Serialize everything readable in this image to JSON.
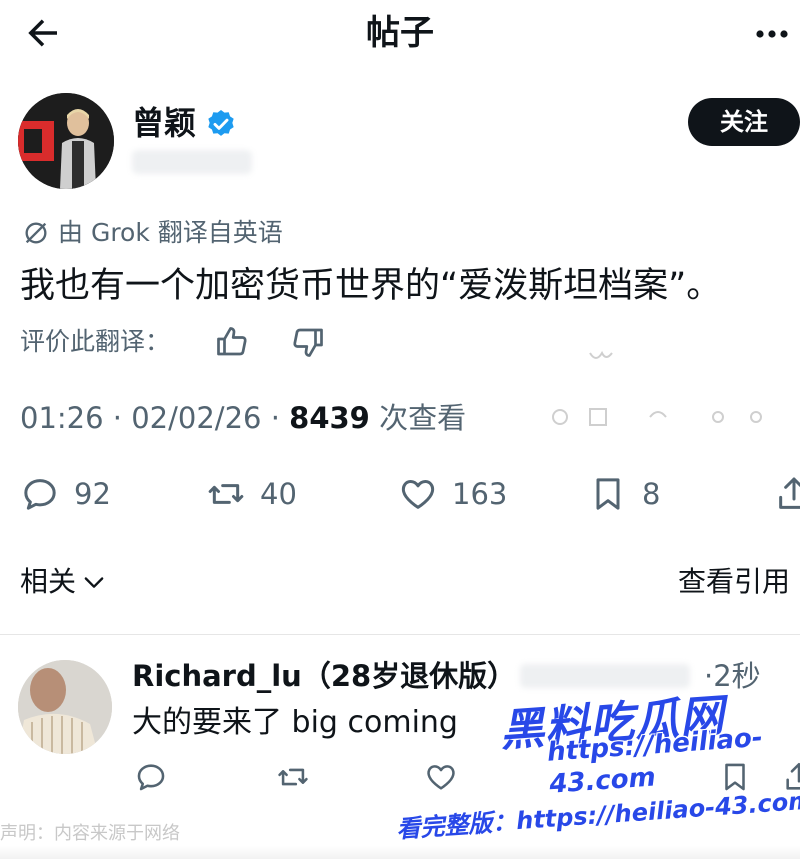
{
  "header": {
    "title": "帖子",
    "back_icon": "arrow-left-icon",
    "more_icon": "more-horizontal-icon"
  },
  "author": {
    "name": "曾颖",
    "verified_icon": "verified-badge-icon",
    "verified_color": "#1d9bf0",
    "follow_label": "关注"
  },
  "post": {
    "translation_note": "由 Grok 翻译自英语",
    "text": "我也有一个加密货币世界的“爱泼斯坦档案”。",
    "rate_translation_label": "评价此翻译：",
    "time": "01:26",
    "date": "02/02/26",
    "views_count": "8439",
    "views_label": "次查看"
  },
  "actions": {
    "replies": "92",
    "reposts": "40",
    "likes": "163",
    "bookmarks": "8"
  },
  "related": {
    "label": "相关",
    "view_quotes": "查看引用"
  },
  "reply": {
    "name": "Richard_lu（28岁退休版）",
    "time": "·2秒",
    "text": "大的要来了 big coming"
  },
  "watermark": {
    "brand": "黑料吃瓜网",
    "url": "https://heiliao-43.com",
    "bottom": "看完整版：https://heiliao-43.com",
    "source_note": "声明：内容来源于网络"
  },
  "colors": {
    "text_primary": "#0f1419",
    "text_secondary": "#536471",
    "watermark_blue": "#2848e8"
  }
}
